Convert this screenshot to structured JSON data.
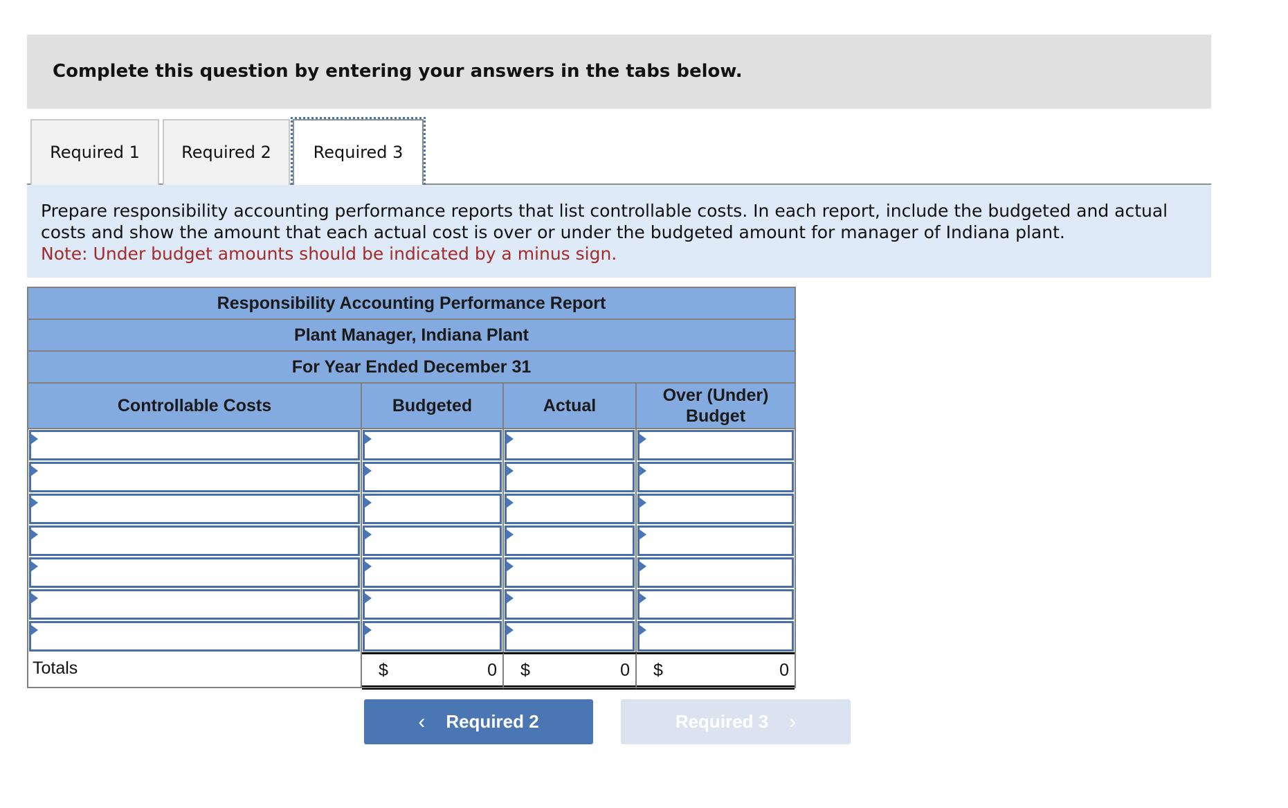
{
  "banner": {
    "text": "Complete this question by entering your answers in the tabs below."
  },
  "tabs": [
    {
      "label": "Required 1",
      "active": false
    },
    {
      "label": "Required 2",
      "active": false
    },
    {
      "label": "Required 3",
      "active": true
    }
  ],
  "instructions": {
    "text": "Prepare responsibility accounting performance reports that list controllable costs. In each report, include the budgeted and actual costs and show the amount that each actual cost is over or under the budgeted amount for manager of Indiana plant.",
    "note": "Note: Under budget amounts should be indicated by a minus sign."
  },
  "report": {
    "title": "Responsibility Accounting Performance Report",
    "subtitle": "Plant Manager, Indiana Plant",
    "period": "For Year Ended December 31",
    "columns": [
      "Controllable Costs",
      "Budgeted",
      "Actual",
      "Over (Under) Budget"
    ],
    "rows": [
      [
        "",
        "",
        "",
        ""
      ],
      [
        "",
        "",
        "",
        ""
      ],
      [
        "",
        "",
        "",
        ""
      ],
      [
        "",
        "",
        "",
        ""
      ],
      [
        "",
        "",
        "",
        ""
      ],
      [
        "",
        "",
        "",
        ""
      ],
      [
        "",
        "",
        "",
        ""
      ]
    ],
    "totals": {
      "label": "Totals",
      "currency": "$",
      "budgeted": "0",
      "actual": "0",
      "over_under": "0"
    }
  },
  "nav": {
    "prev_label": "Required 2",
    "next_label": "Required 3",
    "prev_icon": "‹",
    "next_icon": "›"
  },
  "colors": {
    "accent": "#4a76b3",
    "header_blue": "#84abe0",
    "note_red": "#a52a2a",
    "instruction_bg": "#deeaf7"
  }
}
